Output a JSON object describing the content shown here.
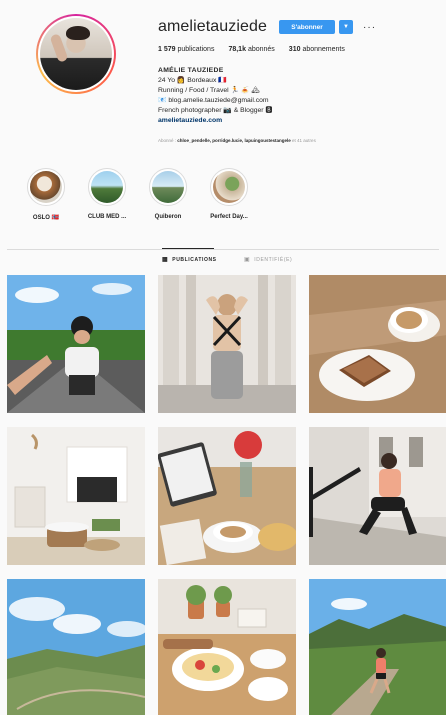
{
  "profile": {
    "username": "amelietauziede",
    "follow_label": "S'abonner",
    "dropdown_icon": "chevron-down-icon",
    "more_label": "···",
    "stats": {
      "publications_count": "1 579",
      "publications_label": "publications",
      "followers_count": "78,1k",
      "followers_label": "abonnés",
      "following_count": "310",
      "following_label": "abonnements"
    },
    "bio": {
      "name": "AMÉLIE TAUZIEDE",
      "line1": "24 Yo 👩 Bordeaux 🇫🇷",
      "line2": "Running / Food / Travel 🏃 🍝 🏔",
      "line3": "📧 blog.amelie.tauziede@gmail.com",
      "line4": "French photographer 📷 & Blogger 🅱",
      "link": "amelietauziede.com"
    },
    "followed_prefix": "Abonné : ",
    "followed_names": "chloe_pendelle, porridge.lucie, lapuingoustestangele",
    "followed_suffix": " et 41 autres"
  },
  "highlights": [
    {
      "label": "OSLO 🇳🇴"
    },
    {
      "label": "CLUB MED ..."
    },
    {
      "label": "Quiberon"
    },
    {
      "label": "Perfect Day..."
    }
  ],
  "tabs": {
    "publications": "PUBLICATIONS",
    "identified": "IDENTIFIÉ(E)"
  },
  "colors": {
    "accent": "#3897f0",
    "text": "#262626",
    "muted": "#999999",
    "background": "#fafafa"
  }
}
